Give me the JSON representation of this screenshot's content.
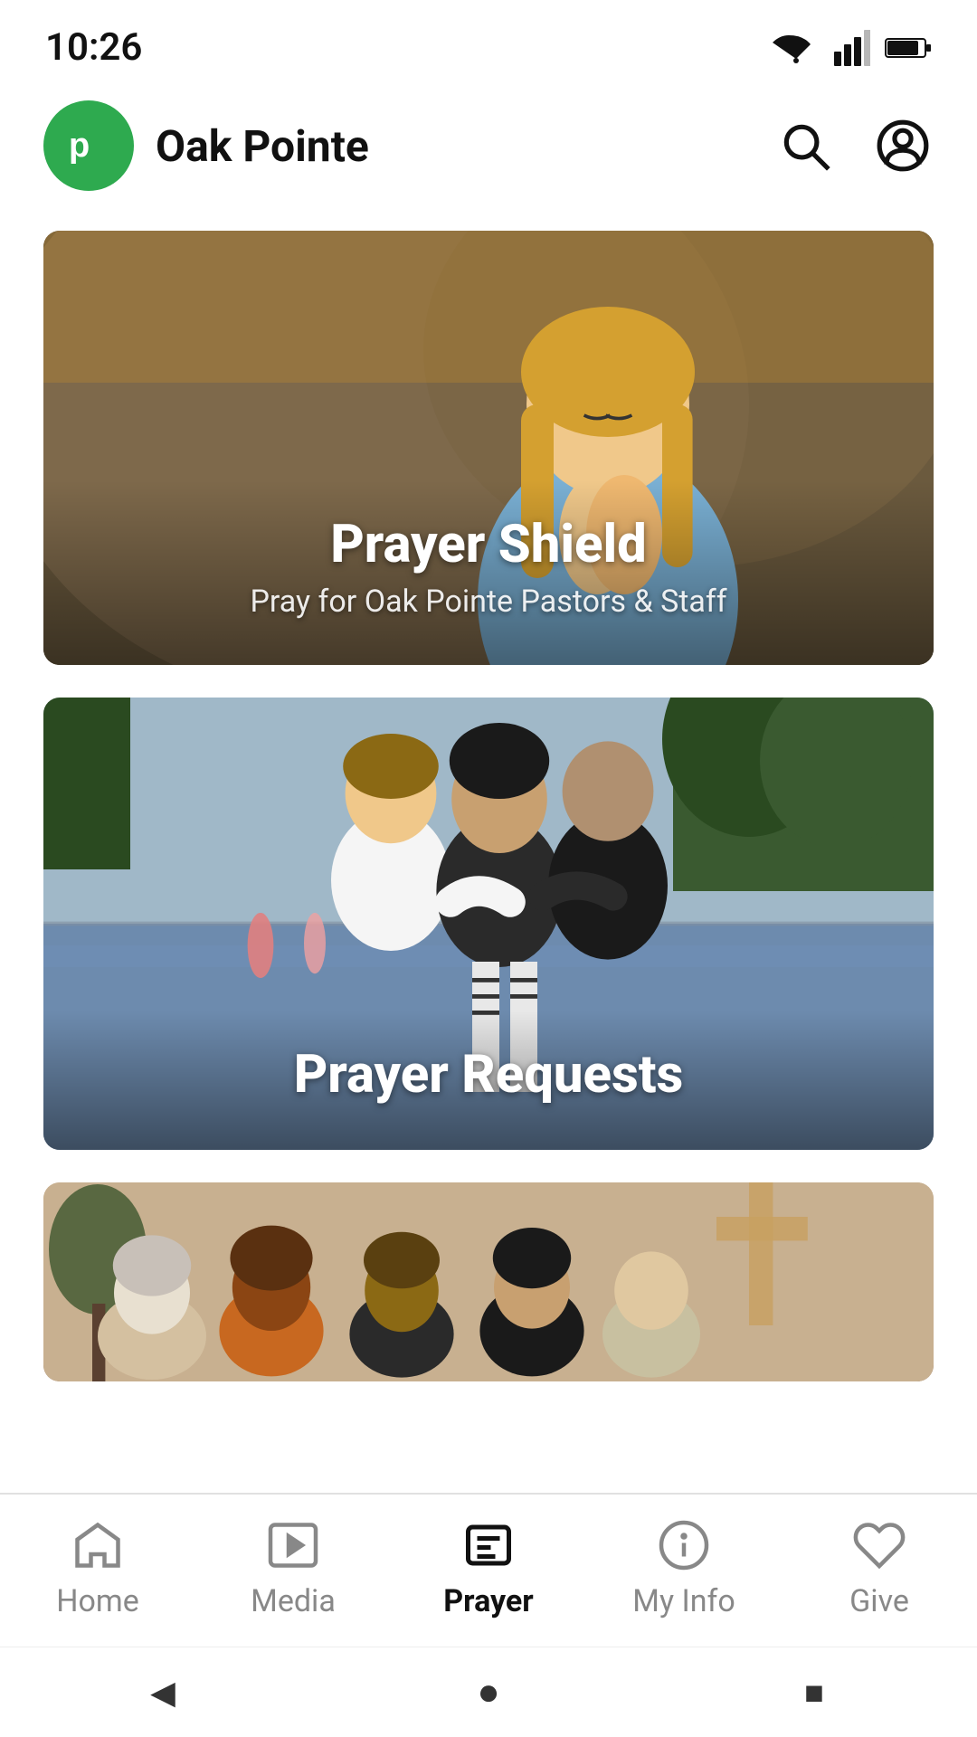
{
  "statusBar": {
    "time": "10:26"
  },
  "header": {
    "appName": "Oak Pointe",
    "logoAlt": "Oak Pointe Logo"
  },
  "cards": [
    {
      "id": "prayer-shield",
      "title": "Prayer Shield",
      "subtitle": "Pray for Oak Pointe Pastors & Staff"
    },
    {
      "id": "prayer-requests",
      "title": "Prayer Requests",
      "subtitle": ""
    },
    {
      "id": "third-card",
      "title": "",
      "subtitle": ""
    }
  ],
  "bottomNav": {
    "items": [
      {
        "id": "home",
        "label": "Home",
        "active": false
      },
      {
        "id": "media",
        "label": "Media",
        "active": false
      },
      {
        "id": "prayer",
        "label": "Prayer",
        "active": true
      },
      {
        "id": "my-info",
        "label": "My Info",
        "active": false
      },
      {
        "id": "give",
        "label": "Give",
        "active": false
      }
    ]
  },
  "androidNav": {
    "back": "◀",
    "home": "●",
    "recent": "■"
  }
}
